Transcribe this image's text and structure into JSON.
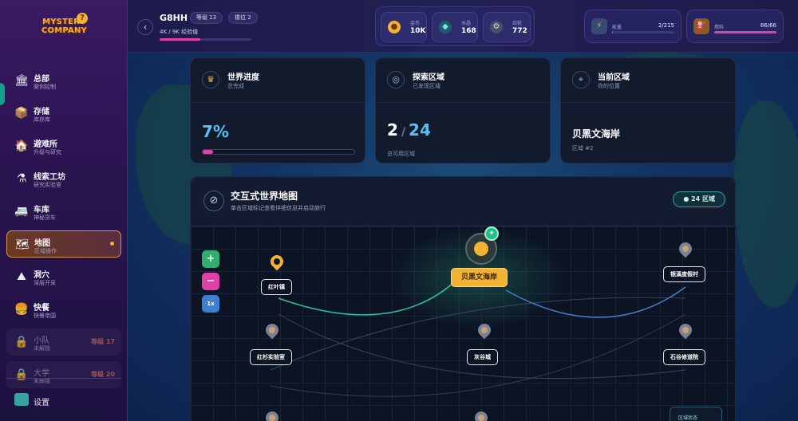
{
  "app": {
    "logo_line1": "MYSTERY",
    "logo_line2": "COMPANY",
    "logo_mark": "?"
  },
  "sidebar": {
    "items": [
      {
        "label": "总部",
        "sub": "案例控制",
        "icon": "hq-icon"
      },
      {
        "label": "存储",
        "sub": "库存库",
        "icon": "storage-icon"
      },
      {
        "label": "避难所",
        "sub": "升级与研究",
        "icon": "shelter-icon"
      },
      {
        "label": "线索工坊",
        "sub": "研究实验室",
        "icon": "lab-icon"
      },
      {
        "label": "车库",
        "sub": "神秘货车",
        "icon": "garage-icon"
      },
      {
        "label": "地图",
        "sub": "区域操作",
        "icon": "map-icon",
        "active": true
      },
      {
        "label": "洞穴",
        "sub": "深层开采",
        "icon": "cave-icon"
      },
      {
        "label": "快餐",
        "sub": "快餐帝国",
        "icon": "fastfood-icon"
      },
      {
        "label": "小队",
        "sub": "未解锁",
        "icon": "lock-icon",
        "locked": true,
        "level": "等级 17"
      },
      {
        "label": "大学",
        "sub": "未解锁",
        "icon": "lock-icon",
        "locked": true,
        "level": "等级 20"
      }
    ],
    "settings_label": "设置"
  },
  "topbar": {
    "back_label": "‹",
    "player_name": "G8HH",
    "level_badge": "等级 13",
    "rank_badge": "楼位 2",
    "xp_text": "4K / 9K 经验值",
    "xp_progress": 0.44,
    "resources": [
      {
        "label": "金币",
        "value": "10K",
        "icon": "coin-icon",
        "color": "#f2b233"
      },
      {
        "label": "水晶",
        "value": "168",
        "icon": "crystal-icon",
        "color": "#3fb0c8"
      },
      {
        "label": "齿轮",
        "value": "772",
        "icon": "gear-icon",
        "color": "#9aa0b8"
      }
    ],
    "energy": {
      "label": "能量",
      "value": "2/215",
      "progress": 0.01,
      "icon": "energy-icon"
    },
    "fuel": {
      "label": "燃料",
      "value": "66/66",
      "progress": 1.0,
      "icon": "fuel-icon"
    }
  },
  "cards": {
    "world_progress": {
      "title": "世界进度",
      "sub": "总完成",
      "value": "7%",
      "progress": 0.07,
      "icon": "trophy-icon"
    },
    "explored": {
      "title": "探索区域",
      "sub": "已发现区域",
      "explored": "2",
      "total": "24",
      "sep": "/",
      "label": "总可用区域",
      "icon": "compass-icon"
    },
    "current": {
      "title": "当前区域",
      "sub": "你的位置",
      "region": "贝黑文海岸",
      "region_id": "区域 #2",
      "icon": "location-icon"
    }
  },
  "map": {
    "title": "交互式世界地图",
    "subtitle": "单击区域标记查看详细信息并启动旅行",
    "region_count": "24 区域",
    "zoom_in": "+",
    "zoom_out": "−",
    "zoom_level": "1x",
    "locations": {
      "red_leaf": "红叶镇",
      "current": "贝黑文海岸",
      "silver_coast": "银溪度假村",
      "redwood_lab": "红杉实验室",
      "grey_valley": "灰谷城",
      "stone_valley": "石谷修道院"
    },
    "status_title": "区域状态",
    "colors": {
      "current": "#f2b233",
      "route_green": "#2fc39a",
      "route_blue": "#3f7fd0"
    }
  }
}
